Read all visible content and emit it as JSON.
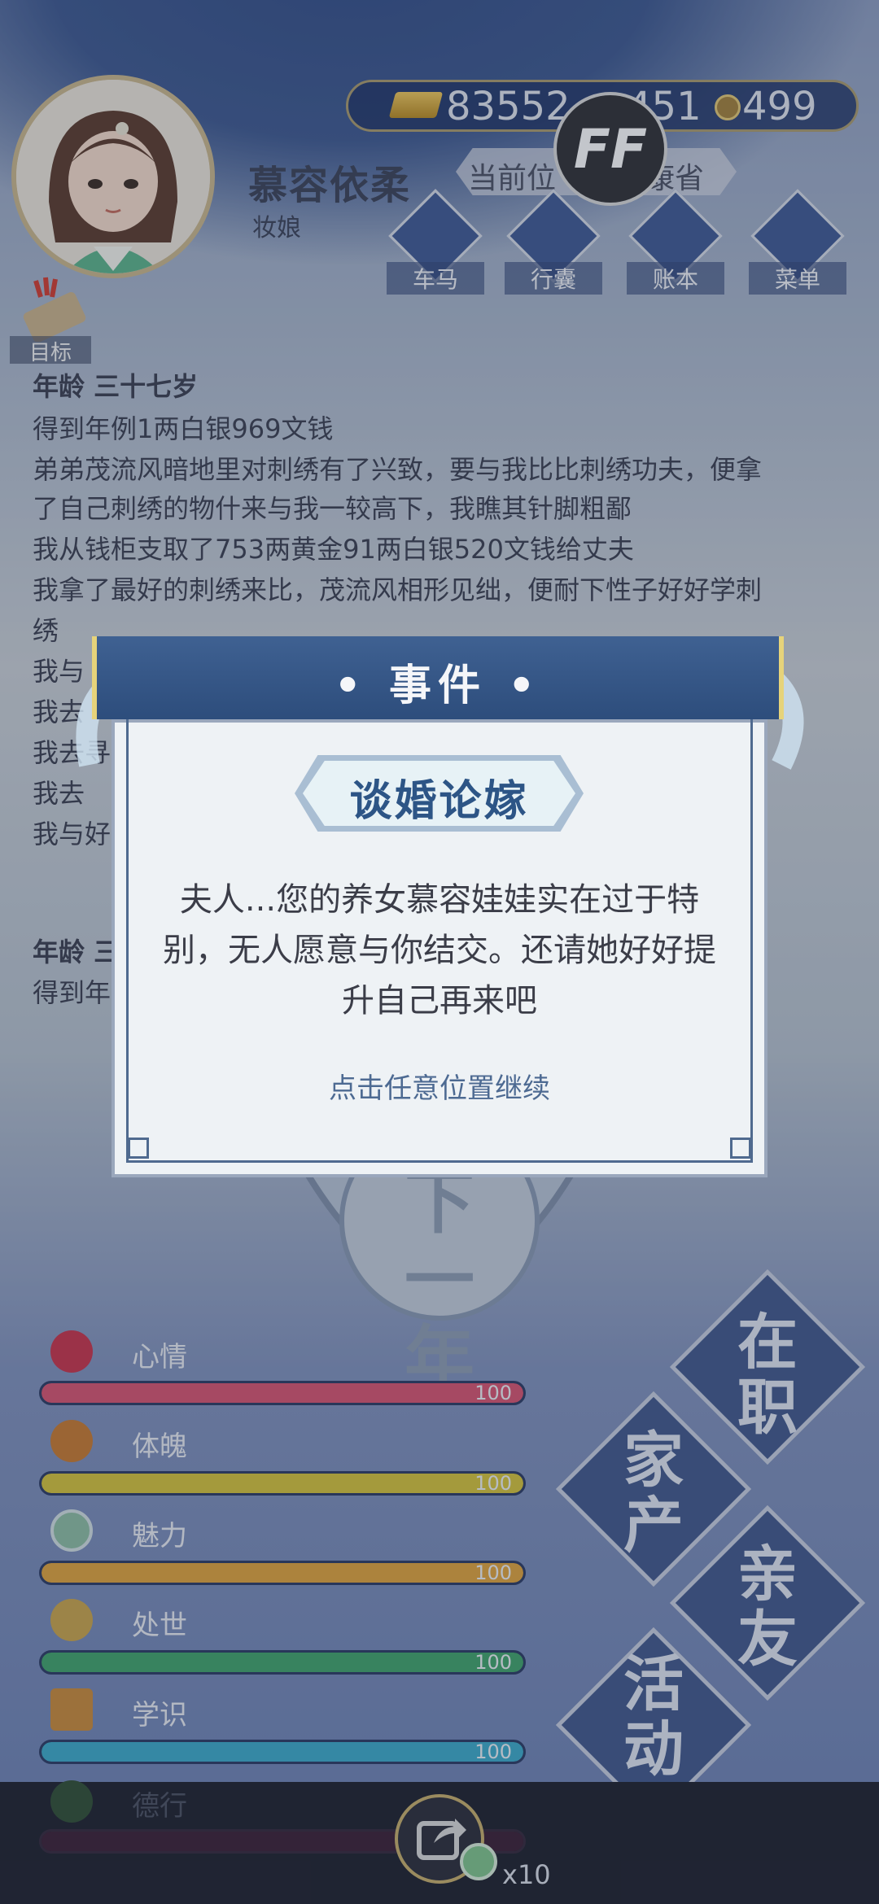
{
  "header": {
    "name": "慕容依柔",
    "title": "妆娘",
    "currency": {
      "gold": "83552",
      "silver": "451",
      "coins": "499"
    },
    "location_prefix": "当前位",
    "location_suffix": "康省",
    "ff_label": "FF",
    "nav": [
      "车马",
      "行囊",
      "账本",
      "菜单"
    ],
    "goal_label": "目标"
  },
  "log": {
    "entries": [
      {
        "type": "age",
        "text": "年龄 三十七岁"
      },
      {
        "type": "text",
        "text": "得到年例1两白银969文钱"
      },
      {
        "type": "text",
        "text": "弟弟茂流风暗地里对刺绣有了兴致，要与我比比刺绣功夫，便拿"
      },
      {
        "type": "text",
        "text": "了自己刺绣的物什来与我一较高下，我瞧其针脚粗鄙"
      },
      {
        "type": "text",
        "text": "我从钱柜支取了753两黄金91两白银520文钱给丈夫"
      },
      {
        "type": "text",
        "text": "我拿了最好的刺绣来比，茂流风相形见绌，便耐下性子好好学刺"
      },
      {
        "type": "text",
        "text": "绣"
      },
      {
        "type": "text",
        "text": "我与"
      },
      {
        "type": "text",
        "text": "我去"
      },
      {
        "type": "text",
        "text": "我去寻"
      },
      {
        "type": "text",
        "text": "我去"
      },
      {
        "type": "text",
        "text": "我与好"
      },
      {
        "type": "gap",
        "text": ""
      },
      {
        "type": "age",
        "text": "年龄 三"
      },
      {
        "type": "text",
        "text": "得到年"
      }
    ]
  },
  "next_year": "下一年",
  "stats": [
    {
      "label": "心情",
      "value": 100,
      "color": "#d7536f",
      "icon": "flower-icon"
    },
    {
      "label": "体魄",
      "value": 100,
      "color": "#d5c23a",
      "icon": "vase-icon"
    },
    {
      "label": "魅力",
      "value": 100,
      "color": "#e0a23b",
      "icon": "jade-icon"
    },
    {
      "label": "处世",
      "value": 100,
      "color": "#3fa36a",
      "icon": "coins-icon"
    },
    {
      "label": "学识",
      "value": 100,
      "color": "#3ba9c9",
      "icon": "books-icon"
    },
    {
      "label": "德行",
      "value": 100,
      "color": "#8e3a6a",
      "icon": "virtue-icon"
    }
  ],
  "side_buttons": [
    "在职",
    "家产",
    "亲友",
    "活动"
  ],
  "bottom": {
    "share_count": "x10"
  },
  "modal": {
    "header": "• 事件 •",
    "event_name": "谈婚论嫁",
    "message": "夫人...您的养女慕容娃娃实在过于特别，无人愿意与你结交。还请她好好提升自己再来吧",
    "continue": "点击任意位置继续"
  }
}
